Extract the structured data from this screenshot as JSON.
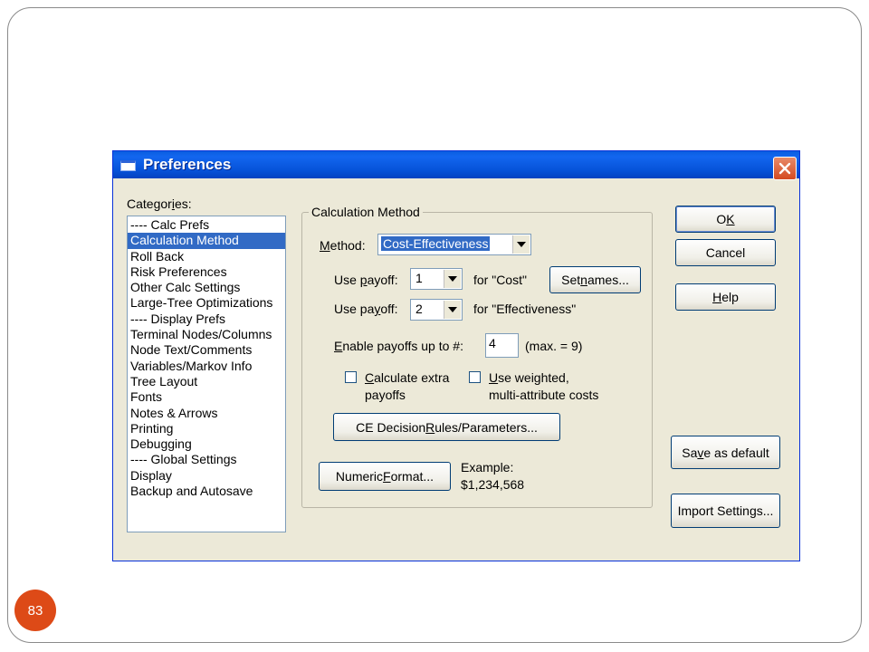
{
  "slide": {
    "page_number": "83"
  },
  "dialog": {
    "title": "Preferences",
    "categories_label_pre": "Categor",
    "categories_label_u": "i",
    "categories_label_post": "es:",
    "categories": [
      "---- Calc Prefs",
      "Calculation Method",
      "Roll Back",
      "Risk Preferences",
      "Other Calc Settings",
      "Large-Tree Optimizations",
      "---- Display Prefs",
      "Terminal Nodes/Columns",
      "Node Text/Comments",
      "Variables/Markov Info",
      "Tree Layout",
      "Fonts",
      "Notes & Arrows",
      "Printing",
      "Debugging",
      "---- Global Settings",
      "Display",
      "Backup and Autosave"
    ],
    "selected_category": "Calculation Method",
    "group_title": "Calculation Method",
    "method": {
      "label_u": "M",
      "label_rest": "ethod:",
      "value": "Cost-Effectiveness"
    },
    "payoff1": {
      "label_pre": "Use ",
      "label_u": "p",
      "label_post": "ayoff:",
      "value": "1",
      "for_text": "for \"Cost\""
    },
    "payoff2": {
      "label_pre": "Use pa",
      "label_u": "y",
      "label_post": "off:",
      "value": "2",
      "for_text": "for \"Effectiveness\""
    },
    "set_names": {
      "pre": "Set ",
      "u": "n",
      "post": "ames..."
    },
    "enable": {
      "label_u": "E",
      "label_rest": "nable payoffs up to #:",
      "value": "4",
      "max_text": "(max. = 9)"
    },
    "calc_extra": {
      "line1_u": "C",
      "line1_rest": "alculate extra",
      "line2": "payoffs",
      "checked": false
    },
    "weighted": {
      "line1_u": "U",
      "line1_rest": "se weighted,",
      "line2": "multi-attribute costs",
      "checked": false
    },
    "ce_button": {
      "pre": "CE Decision ",
      "u": "R",
      "post": "ules/Parameters..."
    },
    "numeric_button": {
      "pre": "Numeric ",
      "u": "F",
      "post": "ormat..."
    },
    "example": {
      "label": "Example:",
      "value": "$1,234,568"
    },
    "ok": {
      "pre": "O",
      "u": "K",
      "post": ""
    },
    "cancel": "Cancel",
    "help": {
      "pre": "",
      "u": "H",
      "post": "elp"
    },
    "save_default": {
      "pre": "Sa",
      "u": "v",
      "post": "e as default"
    },
    "import": "Import Settings..."
  }
}
